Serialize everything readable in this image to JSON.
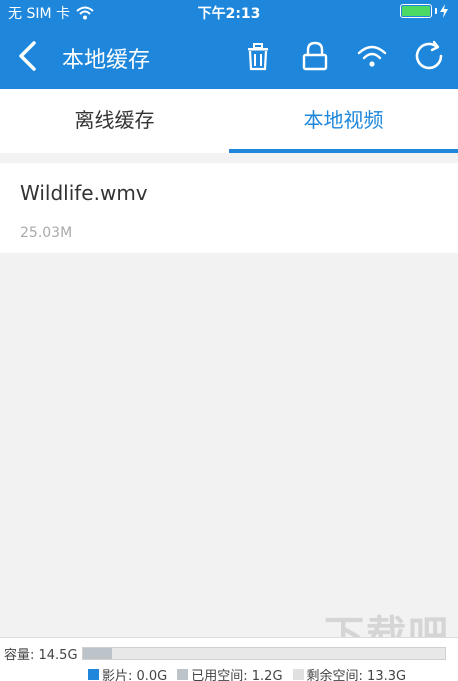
{
  "status_bar": {
    "carrier": "无 SIM 卡",
    "time": "下午2:13"
  },
  "nav": {
    "title": "本地缓存"
  },
  "tabs": [
    {
      "label": "离线缓存",
      "active": false
    },
    {
      "label": "本地视频",
      "active": true
    }
  ],
  "files": [
    {
      "name": "Wildlife.wmv",
      "size": "25.03M"
    }
  ],
  "storage": {
    "capacity_label": "容量: 14.5G",
    "used_fraction": 0.08,
    "legend": [
      {
        "label": "影片: 0.0G",
        "color": "#1e87db"
      },
      {
        "label": "已用空间: 1.2G",
        "color": "#bcc3c9"
      },
      {
        "label": "剩余空间: 13.3G",
        "color": "#e0e0e0"
      }
    ]
  },
  "watermark": "下载吧",
  "colors": {
    "accent": "#1e87db",
    "battery": "#4cd964"
  }
}
